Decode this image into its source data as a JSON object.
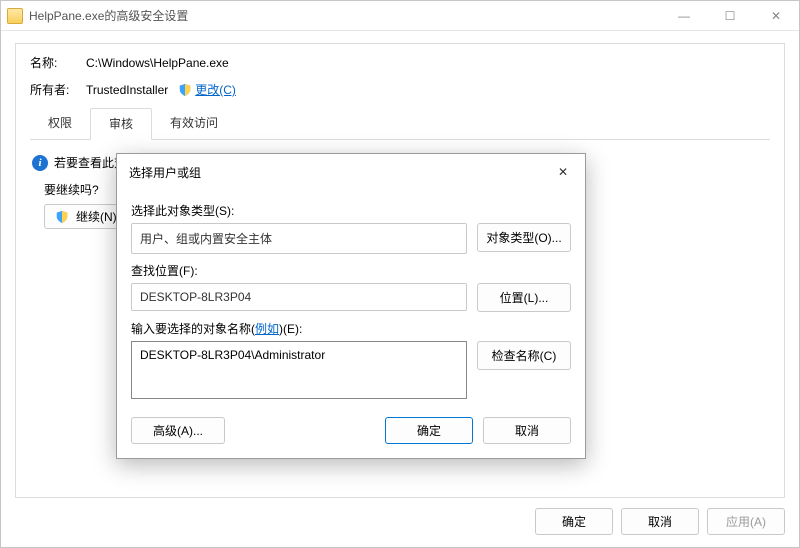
{
  "window": {
    "title": "HelpPane.exe的高级安全设置",
    "min": "—",
    "max": "☐",
    "close": "✕"
  },
  "header": {
    "name_label": "名称:",
    "name_value": "C:\\Windows\\HelpPane.exe",
    "owner_label": "所有者:",
    "owner_value": "TrustedInstaller",
    "change_link": "更改(C)"
  },
  "tabs": {
    "perm": "权限",
    "audit": "审核",
    "effective": "有效访问"
  },
  "info_text": "若要查看此对象的审核属性，则你必须是管理员，或者拥有适当的特权。",
  "continue": {
    "prompt": "要继续吗?",
    "button": "继续(N)"
  },
  "modal": {
    "title": "选择用户或组",
    "close": "✕",
    "object_type_label": "选择此对象类型(S):",
    "object_type_value": "用户、组或内置安全主体",
    "object_type_btn": "对象类型(O)...",
    "location_label": "查找位置(F):",
    "location_value": "DESKTOP-8LR3P04",
    "location_btn": "位置(L)...",
    "names_label_pre": "输入要选择的对象名称(",
    "names_label_link": "例如",
    "names_label_post": ")(E):",
    "names_value": "DESKTOP-8LR3P04\\Administrator",
    "check_btn": "检查名称(C)",
    "advanced_btn": "高级(A)...",
    "ok": "确定",
    "cancel": "取消"
  },
  "footer": {
    "ok": "确定",
    "cancel": "取消",
    "apply": "应用(A)"
  }
}
